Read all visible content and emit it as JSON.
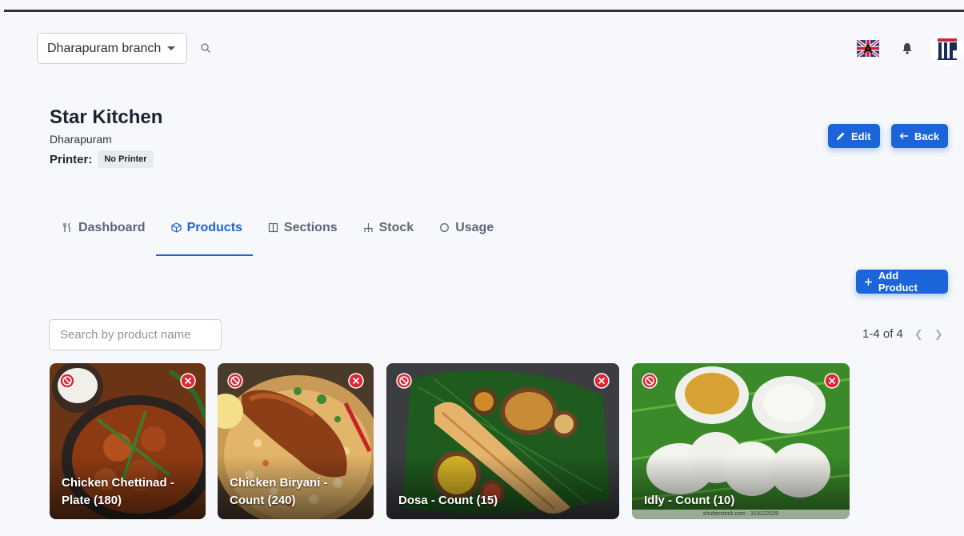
{
  "header": {
    "branch": "Dharapuram branch",
    "icons": {
      "search": "search-icon",
      "language": "uk-flag-icon",
      "notifications": "bell-icon",
      "avatar": "avatar-logo"
    }
  },
  "kitchen": {
    "name": "Star Kitchen",
    "location": "Dharapuram",
    "printer_label": "Printer:",
    "printer_value": "No Printer",
    "edit_label": "Edit",
    "back_label": "Back"
  },
  "tabs": [
    {
      "label": "Dashboard",
      "icon": "utensils-icon",
      "active": false
    },
    {
      "label": "Products",
      "icon": "cube-icon",
      "active": true
    },
    {
      "label": "Sections",
      "icon": "columns-icon",
      "active": false
    },
    {
      "label": "Stock",
      "icon": "hierarchy-icon",
      "active": false
    },
    {
      "label": "Usage",
      "icon": "circle-icon",
      "active": false
    }
  ],
  "products_toolbar": {
    "add_label": "Add Product",
    "search_placeholder": "Search by product name",
    "pagination": "1-4 of 4"
  },
  "products": [
    {
      "name": "Chicken Chettinad - Plate (180)"
    },
    {
      "name": "Chicken Biryani - Count (240)"
    },
    {
      "name": "Dosa - Count (15)"
    },
    {
      "name": "Idly - Count (10)",
      "watermark": "shutterstock.com · 319122026"
    }
  ],
  "colors": {
    "primary": "#1c64d9",
    "danger": "#e02637",
    "background": "#f6f8fb"
  }
}
